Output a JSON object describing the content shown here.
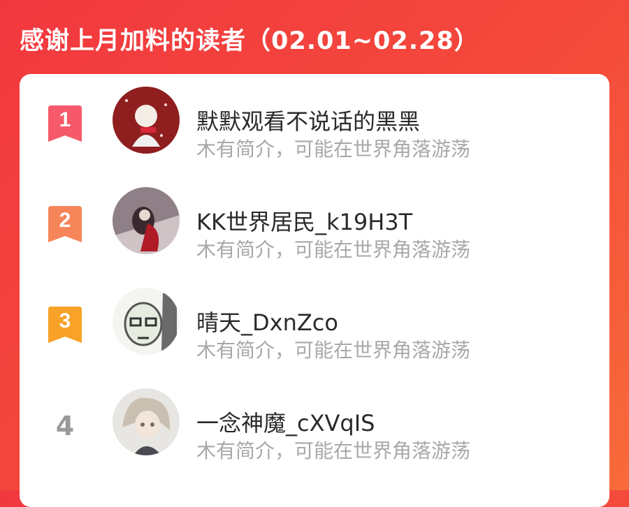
{
  "title": "感谢上月加料的读者（02.01~02.28）",
  "readers": [
    {
      "rank": "1",
      "name": "默默观看不说话的黑黑",
      "bio": "木有简介，可能在世界角落游荡",
      "rank_color": "#f65a6a"
    },
    {
      "rank": "2",
      "name": "KK世界居民_k19H3T",
      "bio": "木有简介，可能在世界角落游荡",
      "rank_color": "#f7855a"
    },
    {
      "rank": "3",
      "name": "晴天_DxnZco",
      "bio": "木有简介，可能在世界角落游荡",
      "rank_color": "#f8a227"
    },
    {
      "rank": "4",
      "name": "一念神魔_cXVqIS",
      "bio": "木有简介，可能在世界角落游荡"
    }
  ]
}
